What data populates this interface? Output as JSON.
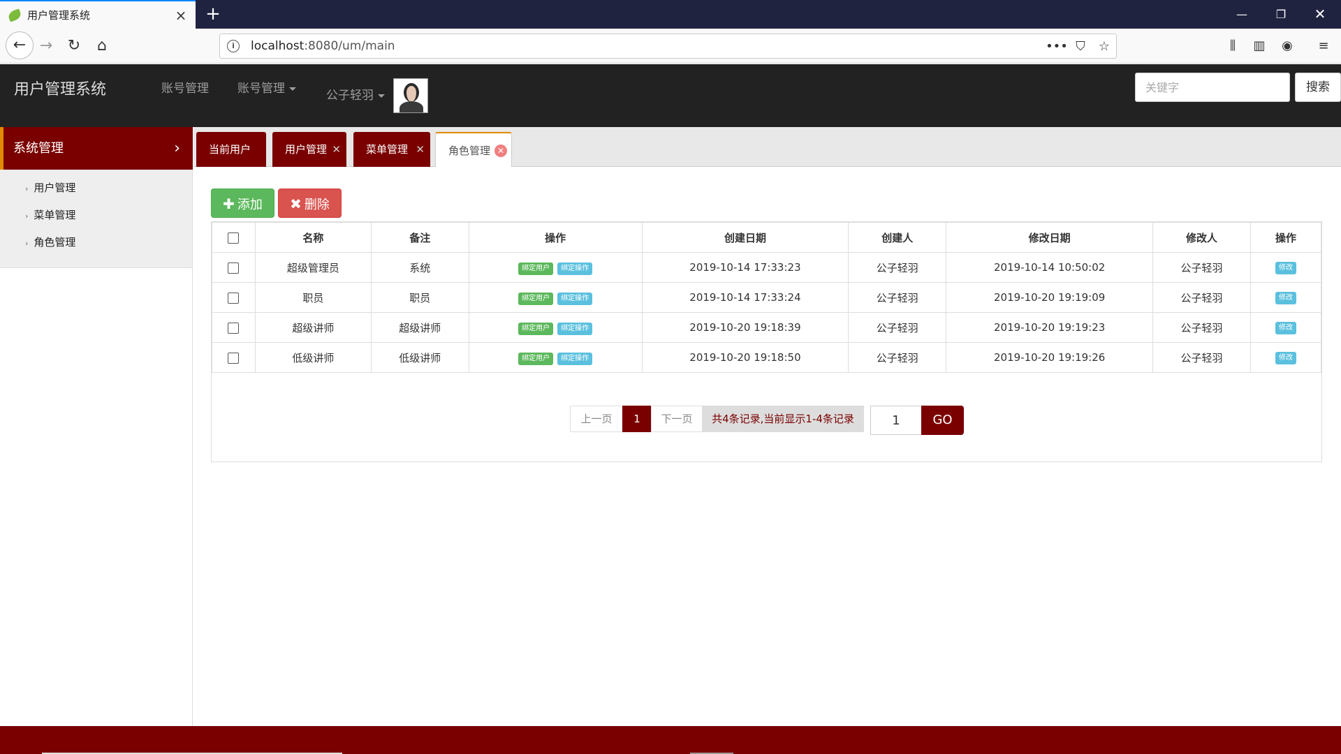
{
  "browser": {
    "tab_title": "用户管理系统",
    "url_host": "localhost",
    "url_rest": ":8080/um/main",
    "menu_dots": "•••"
  },
  "header": {
    "brand": "用户管理系统",
    "nav": [
      "账号管理",
      "账号管理"
    ],
    "user_name": "公子轻羽",
    "search_placeholder": "关键字",
    "search_button": "搜索"
  },
  "sidebar": {
    "title": "系统管理",
    "items": [
      {
        "label": "用户管理"
      },
      {
        "label": "菜单管理"
      },
      {
        "label": "角色管理"
      }
    ]
  },
  "tabs": [
    {
      "label": "当前用户",
      "closable": false
    },
    {
      "label": "用户管理",
      "closable": true
    },
    {
      "label": "菜单管理",
      "closable": true
    },
    {
      "label": "角色管理",
      "closable": true,
      "active": true
    }
  ],
  "toolbar": {
    "add_label": "添加",
    "delete_label": "删除"
  },
  "table": {
    "headers": [
      "名称",
      "备注",
      "操作",
      "创建日期",
      "创建人",
      "修改日期",
      "修改人",
      "操作"
    ],
    "bind_user_label": "绑定用户",
    "bind_op_label": "绑定操作",
    "edit_label": "修改",
    "rows": [
      {
        "name": "超级管理员",
        "remark": "系统",
        "created": "2019-10-14 17:33:23",
        "creator": "公子轻羽",
        "modified": "2019-10-14 10:50:02",
        "modifier": "公子轻羽"
      },
      {
        "name": "职员",
        "remark": "职员",
        "created": "2019-10-14 17:33:24",
        "creator": "公子轻羽",
        "modified": "2019-10-20 19:19:09",
        "modifier": "公子轻羽"
      },
      {
        "name": "超级讲师",
        "remark": "超级讲师",
        "created": "2019-10-20 19:18:39",
        "creator": "公子轻羽",
        "modified": "2019-10-20 19:19:23",
        "modifier": "公子轻羽"
      },
      {
        "name": "低级讲师",
        "remark": "低级讲师",
        "created": "2019-10-20 19:18:50",
        "creator": "公子轻羽",
        "modified": "2019-10-20 19:19:26",
        "modifier": "公子轻羽"
      }
    ]
  },
  "pagination": {
    "prev": "上一页",
    "current": "1",
    "next": "下一页",
    "info": "共4条记录,当前显示1-4条记录",
    "goto_value": "1",
    "go_label": "GO"
  },
  "colors": {
    "brand_red": "#7a0000",
    "accent_orange": "#e08a00",
    "success": "#5cb85c",
    "danger": "#d9534f",
    "info": "#5bc0de"
  }
}
